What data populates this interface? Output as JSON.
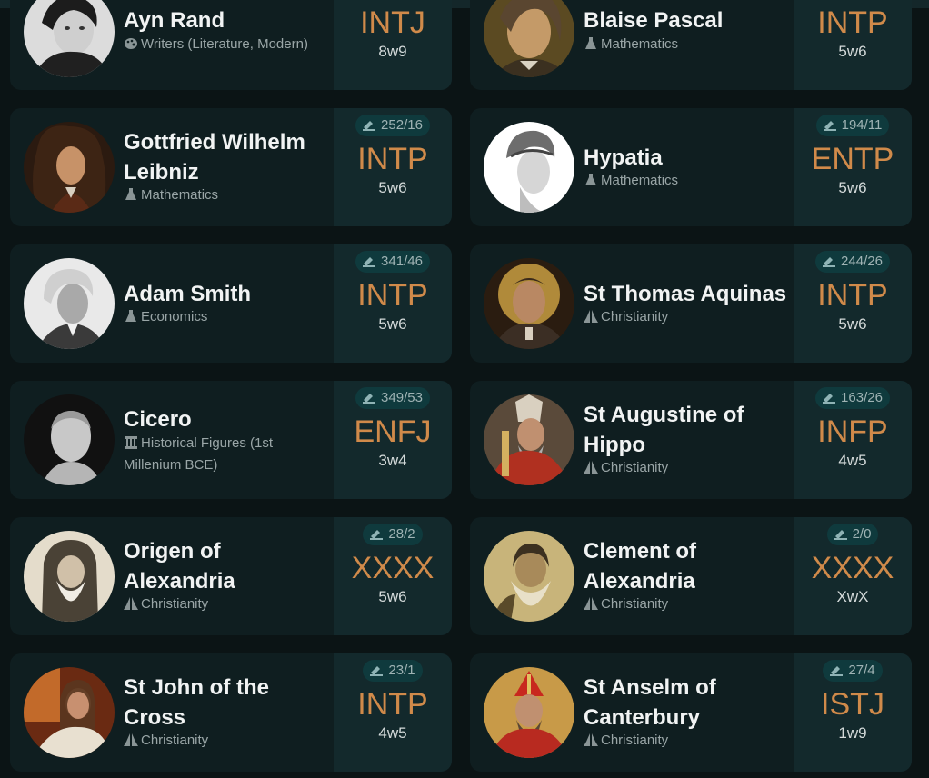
{
  "colors": {
    "background": "#0b1415",
    "card": "#0f1e20",
    "panel": "#13292c",
    "type_text": "#d08a4a",
    "name_text": "#f1f3f3",
    "category_text": "#9aa6a7"
  },
  "cards": [
    {
      "name": "Ayn Rand",
      "category_icon": "palette-icon",
      "category": "Writers (Literature, Modern)",
      "votes": "",
      "mbti": "INTJ",
      "enneagram": "8w9"
    },
    {
      "name": "Blaise Pascal",
      "category_icon": "flask-icon",
      "category": "Mathematics",
      "votes": "",
      "mbti": "INTP",
      "enneagram": "5w6"
    },
    {
      "name": "Gottfried Wilhelm Leibniz",
      "category_icon": "flask-icon",
      "category": "Mathematics",
      "votes": "252/16",
      "mbti": "INTP",
      "enneagram": "5w6"
    },
    {
      "name": "Hypatia",
      "category_icon": "flask-icon",
      "category": "Mathematics",
      "votes": "194/11",
      "mbti": "ENTP",
      "enneagram": "5w6"
    },
    {
      "name": "Adam Smith",
      "category_icon": "flask-icon",
      "category": "Economics",
      "votes": "341/46",
      "mbti": "INTP",
      "enneagram": "5w6"
    },
    {
      "name": "St Thomas Aquinas",
      "category_icon": "praying-hands-icon",
      "category": "Christianity",
      "votes": "244/26",
      "mbti": "INTP",
      "enneagram": "5w6"
    },
    {
      "name": "Cicero",
      "category_icon": "column-icon",
      "category": "Historical Figures (1st Millenium BCE)",
      "votes": "349/53",
      "mbti": "ENFJ",
      "enneagram": "3w4"
    },
    {
      "name": "St Augustine of Hippo",
      "category_icon": "praying-hands-icon",
      "category": "Christianity",
      "votes": "163/26",
      "mbti": "INFP",
      "enneagram": "4w5"
    },
    {
      "name": "Origen of Alexandria",
      "category_icon": "praying-hands-icon",
      "category": "Christianity",
      "votes": "28/2",
      "mbti": "XXXX",
      "enneagram": "5w6"
    },
    {
      "name": "Clement of Alexandria",
      "category_icon": "praying-hands-icon",
      "category": "Christianity",
      "votes": "2/0",
      "mbti": "XXXX",
      "enneagram": "XwX"
    },
    {
      "name": "St John of the Cross",
      "category_icon": "praying-hands-icon",
      "category": "Christianity",
      "votes": "23/1",
      "mbti": "INTP",
      "enneagram": "4w5"
    },
    {
      "name": "St Anselm of Canterbury",
      "category_icon": "praying-hands-icon",
      "category": "Christianity",
      "votes": "27/4",
      "mbti": "ISTJ",
      "enneagram": "1w9"
    }
  ]
}
